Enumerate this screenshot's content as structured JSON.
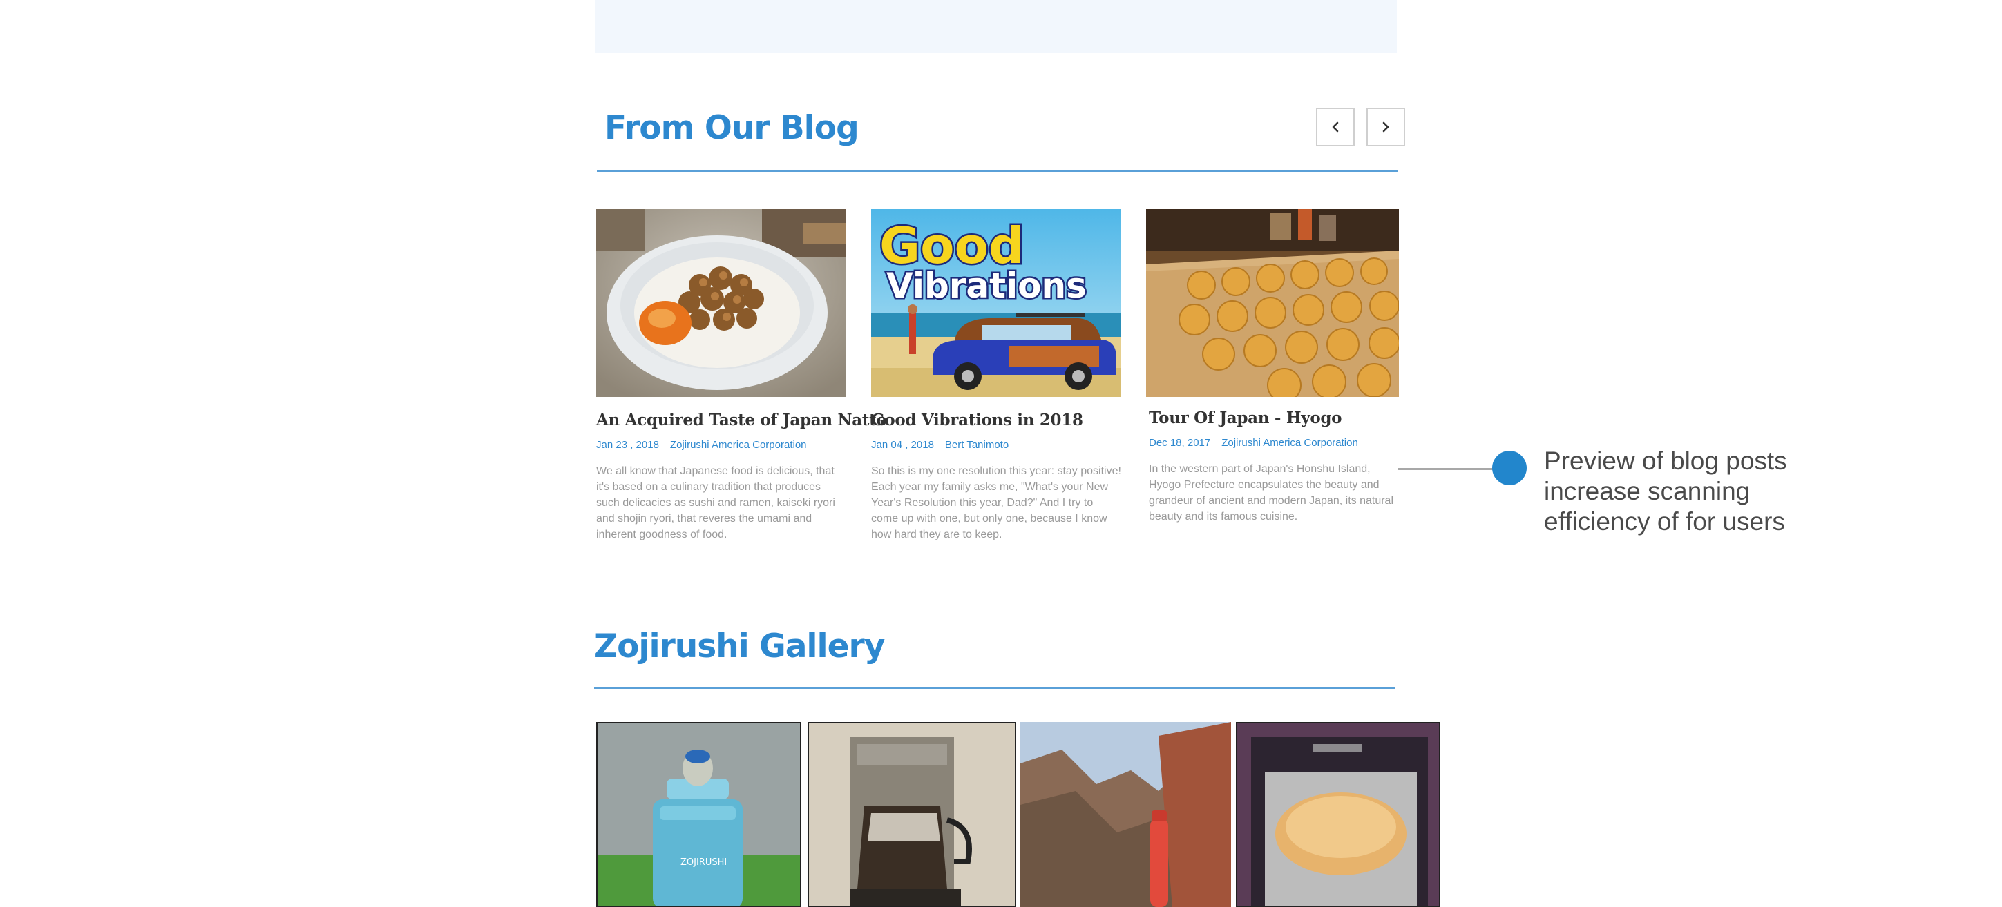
{
  "blog": {
    "heading": "From Our Blog",
    "posts": [
      {
        "title": "An Acquired Taste of Japan Natto",
        "date": "Jan 23 , 2018",
        "author": "Zojirushi America Corporation",
        "excerpt": "We all know that Japanese food is delicious, that it's based on a culinary tradition that produces such delicacies as sushi and ramen, kaiseki ryori and shojin ryori, that reveres the umami and inherent goodness of food."
      },
      {
        "title": "Good Vibrations in 2018",
        "date": "Jan 04 , 2018",
        "author": "Bert Tanimoto",
        "image_text": [
          "Good",
          "Vibrations"
        ],
        "excerpt": "So this is my one resolution this year: stay positive! Each year my family asks me, \"What's your New Year's Resolution this year, Dad?\" And I try to come up with one, but only one, because I know how hard they are to keep."
      },
      {
        "title": "Tour Of Japan - Hyogo",
        "date": "Dec 18, 2017",
        "author": "Zojirushi America Corporation",
        "excerpt": "In the western part of Japan's Honshu Island, Hyogo Prefecture encapsulates the beauty and grandeur of ancient and modern Japan, its natural beauty and its famous cuisine."
      }
    ],
    "prev_icon": "chevron-left-icon",
    "next_icon": "chevron-right-icon"
  },
  "callout": {
    "text": "Preview of blog posts increase scanning efficiency of for users"
  },
  "gallery": {
    "heading": "Zojirushi Gallery",
    "items": [
      {
        "subject": "food-jar-photo",
        "brand_text": "ZOJIRUSHI"
      },
      {
        "subject": "coffee-maker-photo"
      },
      {
        "subject": "canyon-bottle-photo"
      },
      {
        "subject": "bread-maker-photo"
      }
    ]
  },
  "colors": {
    "accent": "#2d88cf",
    "banner": "#f2f7fd",
    "callout_dot": "#2286cc",
    "body_text": "#9a9a9a",
    "title_text": "#333333"
  }
}
